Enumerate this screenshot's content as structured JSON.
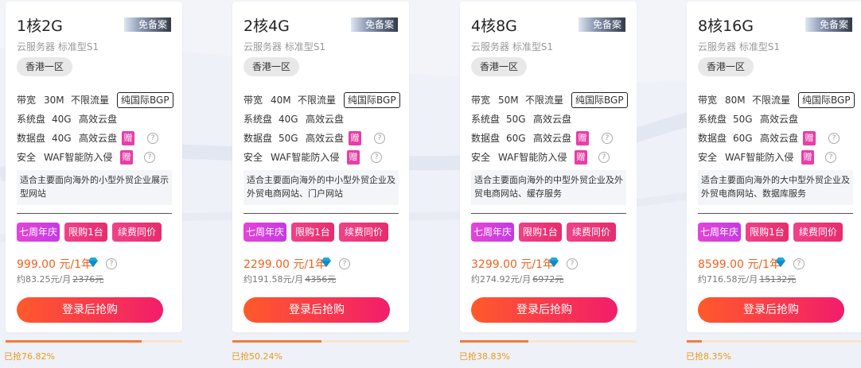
{
  "plans": [
    {
      "title": "1核2G",
      "badge": "免备案",
      "subtitle": "云服务器 标准型S1",
      "region": "香港一区",
      "bandwidth": {
        "label": "带宽",
        "value": "30M",
        "traffic": "不限流量",
        "bgp": "纯国际BGP"
      },
      "system_disk": {
        "label": "系统盘",
        "value": "40G",
        "type": "高效云盘"
      },
      "data_disk": {
        "label": "数据盘",
        "value": "40G",
        "type": "高效云盘",
        "gift": "赠"
      },
      "security": {
        "label": "安全",
        "value": "WAF智能防入侵",
        "gift": "赠"
      },
      "description": "适合主要面向海外的小型外贸企业展示型网站",
      "tags": [
        "七周年庆",
        "限购1台",
        "续费同价"
      ],
      "price": "999.00 元/1年",
      "monthly": "约83.25元/月",
      "original_price": "2376元",
      "button": "登录后抢购",
      "sold_percent": 76.82,
      "sold_text": "已抢76.82%"
    },
    {
      "title": "2核4G",
      "badge": "免备案",
      "subtitle": "云服务器 标准型S1",
      "region": "香港一区",
      "bandwidth": {
        "label": "带宽",
        "value": "40M",
        "traffic": "不限流量",
        "bgp": "纯国际BGP"
      },
      "system_disk": {
        "label": "系统盘",
        "value": "40G",
        "type": "高效云盘"
      },
      "data_disk": {
        "label": "数据盘",
        "value": "50G",
        "type": "高效云盘",
        "gift": "赠"
      },
      "security": {
        "label": "安全",
        "value": "WAF智能防入侵",
        "gift": "赠"
      },
      "description": "适合主要面向海外的中小型外贸企业及外贸电商网站、门户网站",
      "tags": [
        "七周年庆",
        "限购1台",
        "续费同价"
      ],
      "price": "2299.00 元/1年",
      "monthly": "约191.58元/月",
      "original_price": "4356元",
      "button": "登录后抢购",
      "sold_percent": 50.24,
      "sold_text": "已抢50.24%"
    },
    {
      "title": "4核8G",
      "badge": "免备案",
      "subtitle": "云服务器 标准型S1",
      "region": "香港一区",
      "bandwidth": {
        "label": "带宽",
        "value": "50M",
        "traffic": "不限流量",
        "bgp": "纯国际BGP"
      },
      "system_disk": {
        "label": "系统盘",
        "value": "50G",
        "type": "高效云盘"
      },
      "data_disk": {
        "label": "数据盘",
        "value": "60G",
        "type": "高效云盘",
        "gift": "赠"
      },
      "security": {
        "label": "安全",
        "value": "WAF智能防入侵",
        "gift": "赠"
      },
      "description": "适合主要面向海外的中型外贸企业及外贸电商网站、缓存服务",
      "tags": [
        "七周年庆",
        "限购1台",
        "续费同价"
      ],
      "price": "3299.00 元/1年",
      "monthly": "约274.92元/月",
      "original_price": "6972元",
      "button": "登录后抢购",
      "sold_percent": 38.83,
      "sold_text": "已抢38.83%"
    },
    {
      "title": "8核16G",
      "badge": "免备案",
      "subtitle": "云服务器 标准型S1",
      "region": "香港一区",
      "bandwidth": {
        "label": "带宽",
        "value": "80M",
        "traffic": "不限流量",
        "bgp": "纯国际BGP"
      },
      "system_disk": {
        "label": "系统盘",
        "value": "50G",
        "type": "高效云盘"
      },
      "data_disk": {
        "label": "数据盘",
        "value": "60G",
        "type": "高效云盘",
        "gift": "赠"
      },
      "security": {
        "label": "安全",
        "value": "WAF智能防入侵",
        "gift": "赠"
      },
      "description": "适合主要面向海外的大中型外贸企业及外贸电商网站、数据库服务",
      "tags": [
        "七周年庆",
        "限购1台",
        "续费同价"
      ],
      "price": "8599.00 元/1年",
      "monthly": "约716.58元/月",
      "original_price": "15132元",
      "button": "登录后抢购",
      "sold_percent": 8.35,
      "sold_text": "已抢8.35%"
    }
  ],
  "colors": {
    "price": "#f0621f",
    "gift": "#e83ea8",
    "progress_fill": "#f47a3c",
    "progress_track": "#fbe4c9",
    "sold_text": "#e89a1e"
  },
  "icons": {
    "vip": "vip-diamond-icon",
    "help": "question-circle-icon"
  }
}
